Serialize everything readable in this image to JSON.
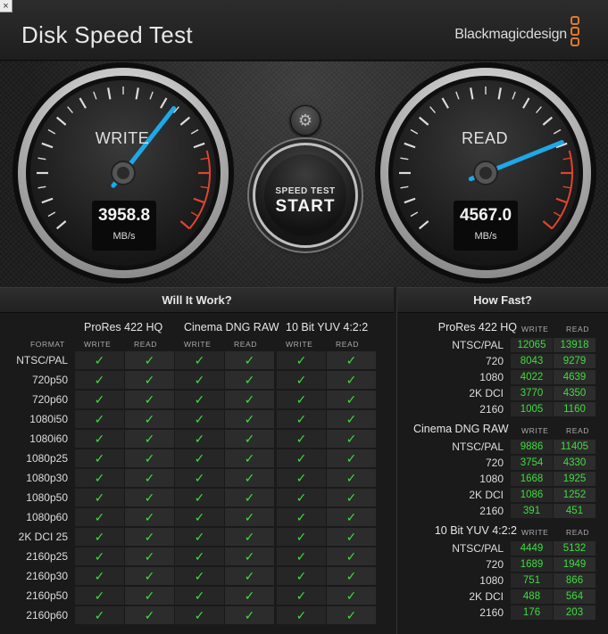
{
  "window": {
    "close_icon": "×"
  },
  "header": {
    "title": "Disk Speed Test",
    "brand": "Blackmagicdesign",
    "brand_color": "#e07a2a"
  },
  "gauges": {
    "write": {
      "label": "WRITE",
      "value": "3958.8",
      "unit": "MB/s",
      "needle_color": "#1ea8e8"
    },
    "read": {
      "label": "READ",
      "value": "4567.0",
      "unit": "MB/s",
      "needle_color": "#1ea8e8"
    }
  },
  "start_button": {
    "small": "SPEED TEST",
    "big": "START"
  },
  "settings_icon": "gear-icon",
  "will_it_work": {
    "title": "Will It Work?",
    "format_header": "FORMAT",
    "groups": [
      {
        "name": "ProRes 422 HQ",
        "write": "WRITE",
        "read": "READ"
      },
      {
        "name": "Cinema DNG RAW",
        "write": "WRITE",
        "read": "READ"
      },
      {
        "name": "10 Bit YUV 4:2:2",
        "write": "WRITE",
        "read": "READ"
      }
    ],
    "check_mark": "✓",
    "check_color": "#3edc3e",
    "formats": [
      "NTSC/PAL",
      "720p50",
      "720p60",
      "1080i50",
      "1080i60",
      "1080p25",
      "1080p30",
      "1080p50",
      "1080p60",
      "2K DCI 25",
      "2160p25",
      "2160p30",
      "2160p50",
      "2160p60"
    ]
  },
  "how_fast": {
    "title": "How Fast?",
    "sections": [
      {
        "name": "ProRes 422 HQ",
        "write": "WRITE",
        "read": "READ",
        "rows": [
          {
            "label": "NTSC/PAL",
            "write": "12065",
            "read": "13918"
          },
          {
            "label": "720",
            "write": "8043",
            "read": "9279"
          },
          {
            "label": "1080",
            "write": "4022",
            "read": "4639"
          },
          {
            "label": "2K DCI",
            "write": "3770",
            "read": "4350"
          },
          {
            "label": "2160",
            "write": "1005",
            "read": "1160"
          }
        ]
      },
      {
        "name": "Cinema DNG RAW",
        "write": "WRITE",
        "read": "READ",
        "rows": [
          {
            "label": "NTSC/PAL",
            "write": "9886",
            "read": "11405"
          },
          {
            "label": "720",
            "write": "3754",
            "read": "4330"
          },
          {
            "label": "1080",
            "write": "1668",
            "read": "1925"
          },
          {
            "label": "2K DCI",
            "write": "1086",
            "read": "1252"
          },
          {
            "label": "2160",
            "write": "391",
            "read": "451"
          }
        ]
      },
      {
        "name": "10 Bit YUV 4:2:2",
        "write": "WRITE",
        "read": "READ",
        "rows": [
          {
            "label": "NTSC/PAL",
            "write": "4449",
            "read": "5132"
          },
          {
            "label": "720",
            "write": "1689",
            "read": "1949"
          },
          {
            "label": "1080",
            "write": "751",
            "read": "866"
          },
          {
            "label": "2K DCI",
            "write": "488",
            "read": "564"
          },
          {
            "label": "2160",
            "write": "176",
            "read": "203"
          }
        ]
      }
    ]
  }
}
